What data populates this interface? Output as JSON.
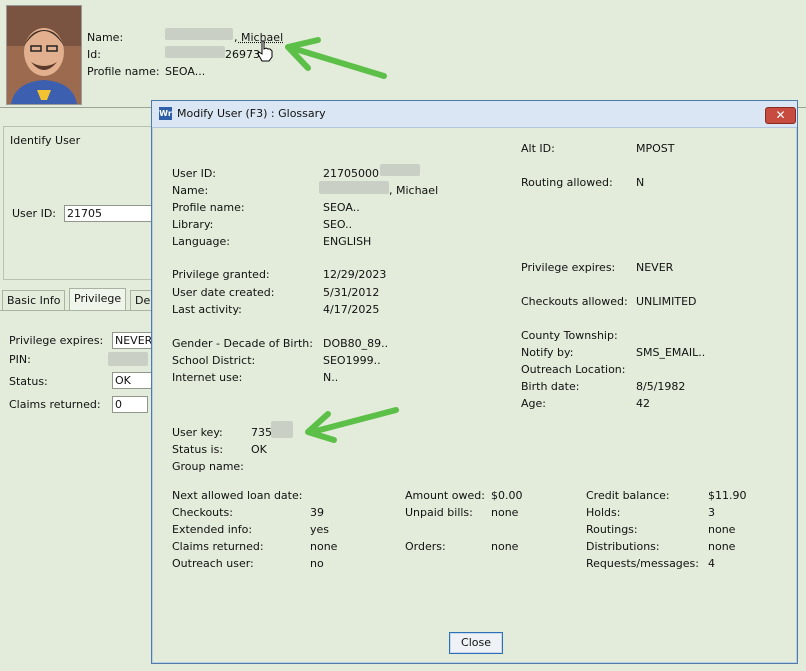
{
  "profile": {
    "name_label": "Name:",
    "name_value": ", Michael",
    "id_label": "Id:",
    "id_value": "26973",
    "profile_label": "Profile name:",
    "profile_value": "SEOA..."
  },
  "identify": {
    "heading": "Identify User",
    "user_id_label": "User ID:",
    "user_id_value": "21705"
  },
  "tabs": [
    "Basic Info",
    "Privilege",
    "De"
  ],
  "privilege": {
    "expires_label": "Privilege expires:",
    "expires_value": "NEVER",
    "pin_label": "PIN:",
    "status_label": "Status:",
    "status_value": "OK",
    "claims_label": "Claims returned:",
    "claims_value": "0"
  },
  "modal": {
    "title": "Modify User (F3) : Glossary",
    "icon_text": "Wr",
    "close_x": "✕",
    "close_button": "Close",
    "left": [
      {
        "label": "User ID:",
        "value": "21705000"
      },
      {
        "label": "Name:",
        "value": ", Michael"
      },
      {
        "label": "Profile name:",
        "value": "SEOA.."
      },
      {
        "label": "Library:",
        "value": "SEO.."
      },
      {
        "label": "Language:",
        "value": "ENGLISH"
      },
      {
        "label": "Privilege granted:",
        "value": "12/29/2023"
      },
      {
        "label": "User date created:",
        "value": "5/31/2012"
      },
      {
        "label": "Last activity:",
        "value": "4/17/2025"
      },
      {
        "label": "Gender - Decade of Birth:",
        "value": "DOB80_89.."
      },
      {
        "label": "School District:",
        "value": "SEO1999.."
      },
      {
        "label": "Internet use:",
        "value": "N.."
      },
      {
        "label": "User key:",
        "value": "735"
      },
      {
        "label": "Status is:",
        "value": "OK"
      },
      {
        "label": "Group name:",
        "value": ""
      }
    ],
    "right": [
      {
        "label": "Alt ID:",
        "value": "MPOST"
      },
      {
        "label": "Routing allowed:",
        "value": "N"
      },
      {
        "label": "Privilege expires:",
        "value": "NEVER"
      },
      {
        "label": "Checkouts allowed:",
        "value": "UNLIMITED"
      },
      {
        "label": "County Township:",
        "value": ""
      },
      {
        "label": "Notify by:",
        "value": "SMS_EMAIL.."
      },
      {
        "label": "Outreach Location:",
        "value": ""
      },
      {
        "label": "Birth date:",
        "value": "8/5/1982"
      },
      {
        "label": "Age:",
        "value": "42"
      }
    ],
    "bottom_col1": [
      {
        "label": "Next allowed loan date:",
        "value": ""
      },
      {
        "label": "Checkouts:",
        "value": "39"
      },
      {
        "label": "Extended info:",
        "value": "yes"
      },
      {
        "label": "Claims returned:",
        "value": "none"
      },
      {
        "label": "Outreach user:",
        "value": "no"
      }
    ],
    "bottom_col2": [
      {
        "label": "Amount owed:",
        "value": "$0.00"
      },
      {
        "label": "Unpaid bills:",
        "value": "none"
      },
      {
        "label": "Orders:",
        "value": "none"
      }
    ],
    "bottom_col3": [
      {
        "label": "Credit balance:",
        "value": "$11.90"
      },
      {
        "label": "Holds:",
        "value": "3"
      },
      {
        "label": "Routings:",
        "value": "none"
      },
      {
        "label": "Distributions:",
        "value": "none"
      },
      {
        "label": "Requests/messages:",
        "value": "4"
      }
    ]
  },
  "colors": {
    "background": "#e3ecdb",
    "annotation_arrow": "#5cbf47",
    "close_x_bg": "#c74b3f",
    "close_button_border": "#2b6fb6"
  }
}
